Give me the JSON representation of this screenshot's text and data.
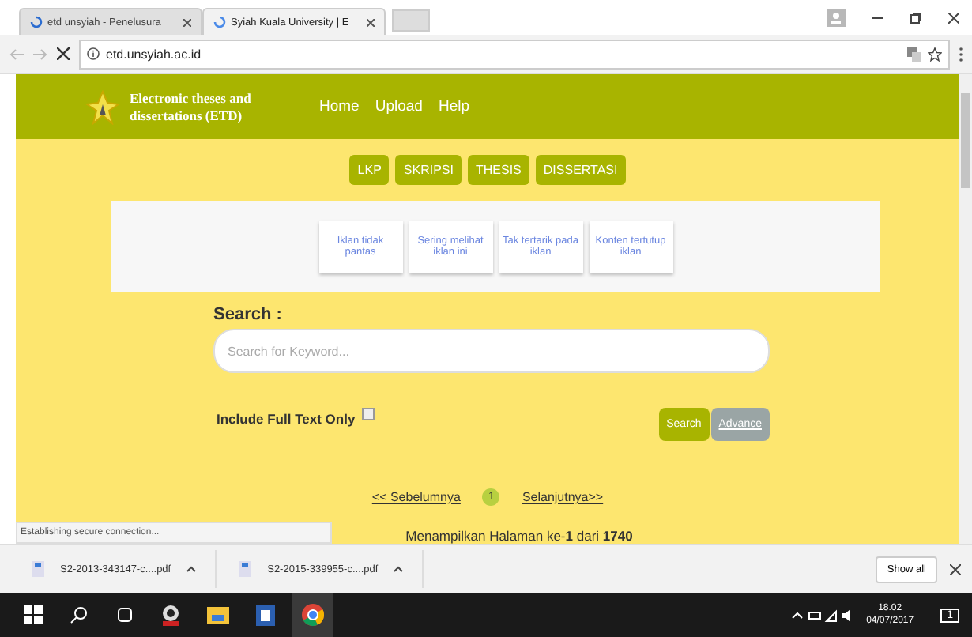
{
  "browser": {
    "tabs": [
      {
        "title": "etd unsyiah - Penelusura",
        "selected": false
      },
      {
        "title": "Syiah Kuala University | E",
        "selected": true
      }
    ],
    "address": "etd.unsyiah.ac.id"
  },
  "site": {
    "title": "Electronic theses and dissertations (ETD)",
    "nav": [
      "Home",
      "Upload",
      "Help"
    ]
  },
  "categories": [
    "LKP",
    "SKRIPSI",
    "THESIS",
    "DISSERTASI"
  ],
  "ad_options": [
    "Iklan tidak pantas",
    "Sering melihat iklan ini",
    "Tak tertarik pada iklan",
    "Konten tertutup iklan"
  ],
  "search": {
    "label": "Search :",
    "placeholder": "Search for Keyword...",
    "full_text_label": "Include Full Text Only",
    "full_text_checked": false,
    "buttons": [
      "Search",
      "Advance"
    ]
  },
  "pagination": {
    "prev": "<< Sebelumnya",
    "page": "1",
    "next": "Selanjutnya>>",
    "summary": "Menampilkan Halaman ke-**1** dari **1740**"
  },
  "status": "Establishing secure connection...",
  "downloads": {
    "files": [
      "S2-2013-343147-c....pdf",
      "S2-2015-339955-c....pdf"
    ],
    "show_all": "Show all"
  },
  "taskbar": {
    "time": "18.02",
    "date": "04/07/2017",
    "notifications": "1"
  }
}
